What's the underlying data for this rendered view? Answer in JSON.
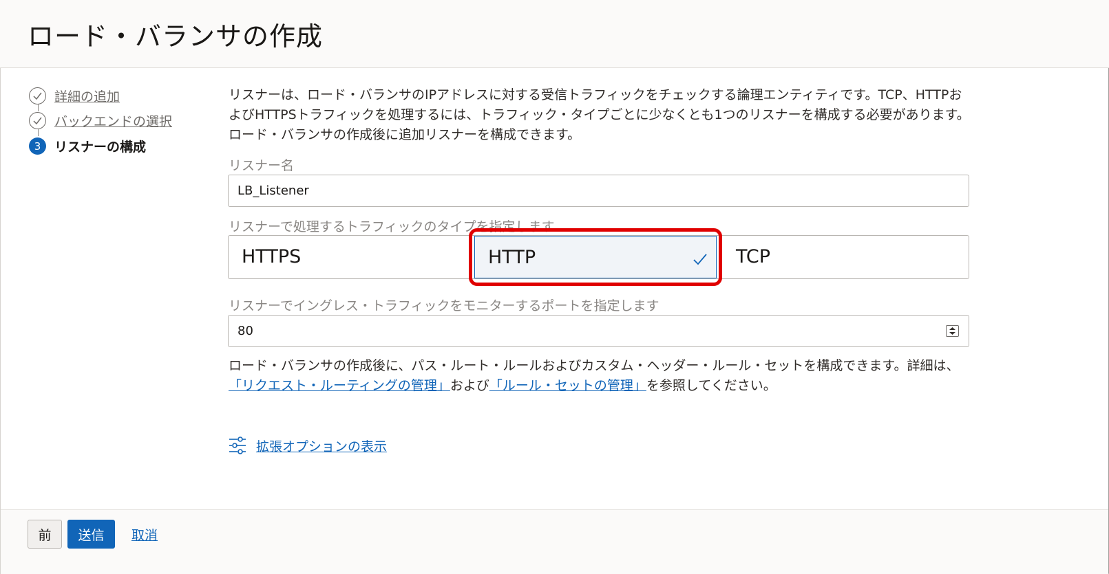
{
  "header": {
    "title": "ロード・バランサの作成"
  },
  "steps": [
    {
      "label": "詳細の追加",
      "state": "done"
    },
    {
      "label": "バックエンドの選択",
      "state": "done"
    },
    {
      "number": "3",
      "label": "リスナーの構成",
      "state": "current"
    }
  ],
  "description": "リスナーは、ロード・バランサのIPアドレスに対する受信トラフィックをチェックする論理エンティティです。TCP、HTTPおよびHTTPSトラフィックを処理するには、トラフィック・タイプごとに少なくとも1つのリスナーを構成する必要があります。ロード・バランサの作成後に追加リスナーを構成できます。",
  "listener_name": {
    "label": "リスナー名",
    "value": "LB_Listener"
  },
  "traffic_type": {
    "label": "リスナーで処理するトラフィックのタイプを指定します",
    "options": [
      "HTTPS",
      "HTTP",
      "TCP"
    ],
    "selected": "HTTP"
  },
  "port": {
    "label": "リスナーでイングレス・トラフィックをモニターするポートを指定します",
    "value": "80"
  },
  "note": {
    "text_before": "ロード・バランサの作成後に、パス・ルート・ルールおよびカスタム・ヘッダー・ルール・セットを構成できます。詳細は、",
    "link1": "「リクエスト・ルーティングの管理」",
    "text_middle": "および",
    "link2": "「ルール・セットの管理」",
    "text_after": "を参照してください。"
  },
  "advanced": {
    "label": "拡張オプションの表示",
    "icon": "sliders-icon"
  },
  "footer": {
    "prev_label": "前",
    "submit_label": "送信",
    "cancel_label": "取消"
  },
  "colors": {
    "accent": "#1165b8",
    "highlight": "#e00000"
  }
}
